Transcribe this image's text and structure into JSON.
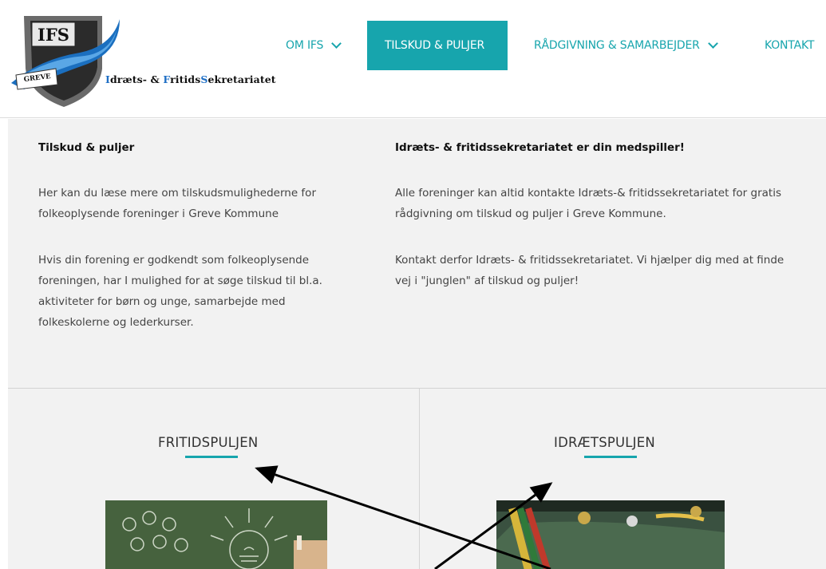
{
  "logo": {
    "abbr": "IFS",
    "city": "GREVE",
    "tagline_parts": [
      "I",
      "dræts- & ",
      "F",
      "ritids",
      "S",
      "ekretariatet"
    ]
  },
  "nav": {
    "items": [
      {
        "label": "OM IFS",
        "dropdown": true
      },
      {
        "label": "TILSKUD & PULJER",
        "active": true
      },
      {
        "label": "RÅDGIVNING & SAMARBEJDER",
        "dropdown": true
      },
      {
        "label": "KONTAKT"
      }
    ]
  },
  "info": {
    "left": {
      "title": "Tilskud & puljer",
      "p1_lines": [
        "Her kan du læse mere om tilskudsmulighederne for",
        "folkeoplysende foreninger i Greve Kommune"
      ],
      "p2_lines": [
        "Hvis din forening er godkendt som folkeoplysende",
        "foreningen, har I mulighed for at søge tilskud til bl.a.",
        "aktiviteter for børn og unge, samarbejde med",
        "folkeskolerne og lederkurser."
      ]
    },
    "right": {
      "title": "Idræts- & fritidssekretariatet er din medspiller!",
      "p1_lines": [
        "Alle foreninger kan altid kontakte Idræts-& fritidssekretariatet for gratis",
        "rådgivning om tilskud og puljer i Greve Kommune."
      ],
      "p2_lines": [
        "Kontakt derfor Idræts- & fritidssekretariatet. Vi hjælper dig med at finde",
        "vej i \"junglen\" af tilskud og puljer!"
      ]
    }
  },
  "cards": [
    {
      "title": "FRITIDSPULJEN",
      "image": "chalkboard-lightbulbs"
    },
    {
      "title": "IDRÆTSPULJEN",
      "image": "medals-ribbons"
    }
  ],
  "colors": {
    "accent": "#17a5ad",
    "section_bg": "#f2f2f2",
    "arrow": "#000000"
  }
}
